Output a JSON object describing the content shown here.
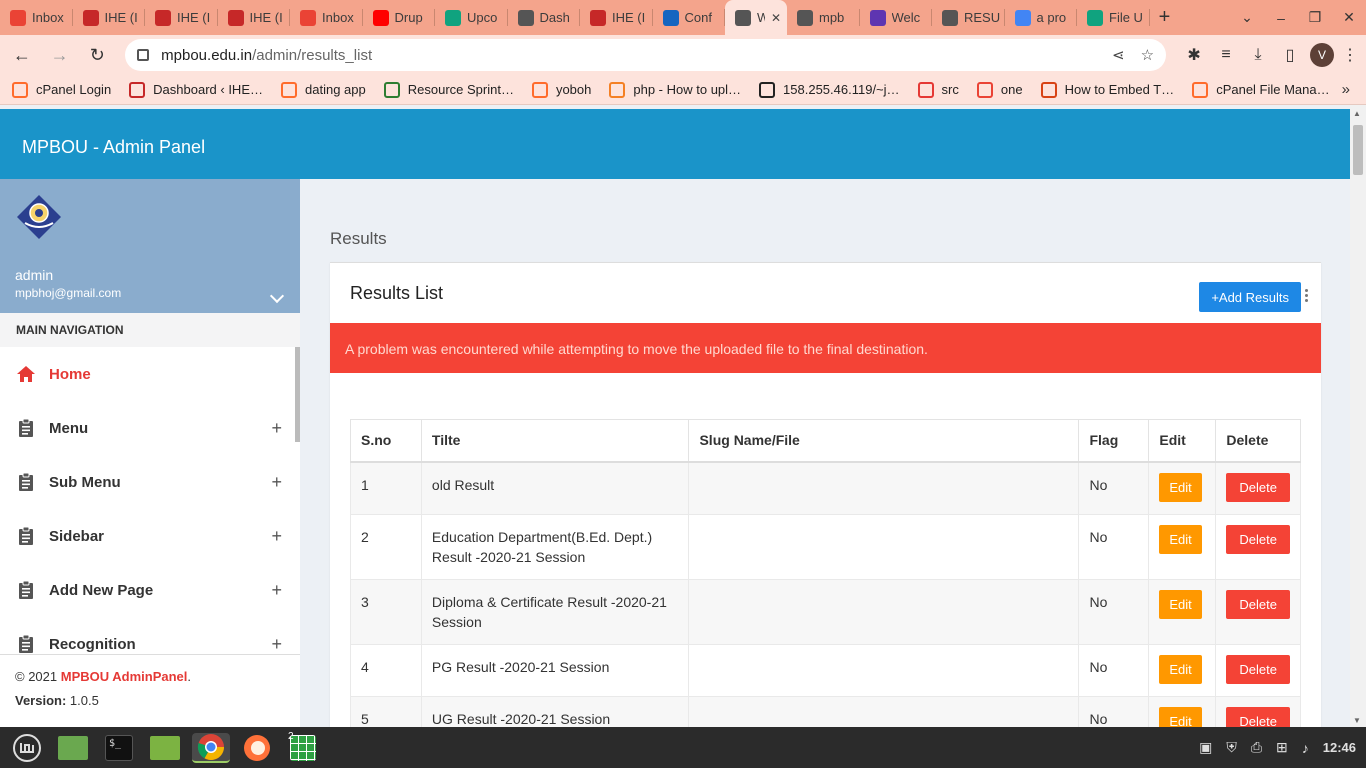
{
  "browser": {
    "tabs": [
      {
        "title": "Inbox",
        "icon": "gmail-icon",
        "color": "#ea4335"
      },
      {
        "title": "IHE (I",
        "icon": "ihe-icon",
        "color": "#c62828"
      },
      {
        "title": "IHE (I",
        "icon": "ihe-icon",
        "color": "#c62828"
      },
      {
        "title": "IHE (I",
        "icon": "ihe-icon",
        "color": "#c62828"
      },
      {
        "title": "Inbox",
        "icon": "gmail-icon",
        "color": "#ea4335"
      },
      {
        "title": "Drup",
        "icon": "youtube-icon",
        "color": "#ff0000"
      },
      {
        "title": "Upco",
        "icon": "chatgpt-icon",
        "color": "#10a37f"
      },
      {
        "title": "Dash",
        "icon": "globe-icon",
        "color": "#555555"
      },
      {
        "title": "IHE (I",
        "icon": "ihe-icon",
        "color": "#c62828"
      },
      {
        "title": "Conf",
        "icon": "site-icon",
        "color": "#1565c0"
      },
      {
        "title": "W",
        "icon": "globe-icon",
        "color": "#555555",
        "active": true
      },
      {
        "title": "mpb",
        "icon": "globe-icon",
        "color": "#555555"
      },
      {
        "title": "Welc",
        "icon": "mpbou-icon",
        "color": "#5e35b1"
      },
      {
        "title": "RESU",
        "icon": "globe-icon",
        "color": "#555555"
      },
      {
        "title": "a pro",
        "icon": "google-icon",
        "color": "#4285f4"
      },
      {
        "title": "File U",
        "icon": "chatgpt-icon",
        "color": "#10a37f"
      }
    ],
    "url_host": "mpbou.edu.in",
    "url_path": "/admin/results_list",
    "profile_initial": "V",
    "bookmarks": [
      {
        "label": "cPanel Login",
        "icon": "cpanel-icon"
      },
      {
        "label": "Dashboard ‹ IHE…",
        "icon": "ihe-icon"
      },
      {
        "label": "dating app",
        "icon": "cpanel-icon"
      },
      {
        "label": "Resource Sprint…",
        "icon": "plus-square-icon"
      },
      {
        "label": "yoboh",
        "icon": "cpanel-icon"
      },
      {
        "label": "php - How to upl…",
        "icon": "stackoverflow-icon"
      },
      {
        "label": "158.255.46.119/~j…",
        "icon": "globe-icon"
      },
      {
        "label": "src",
        "icon": "fire-icon"
      },
      {
        "label": "one",
        "icon": "gmail-icon"
      },
      {
        "label": "How to Embed T…",
        "icon": "rooster-icon"
      },
      {
        "label": "cPanel File Mana…",
        "icon": "cpanel-icon"
      }
    ]
  },
  "app": {
    "brand": "MPBOU - Admin Panel",
    "user": {
      "name": "admin",
      "email": "mpbhoj@gmail.com"
    },
    "nav_header": "MAIN NAVIGATION",
    "nav": [
      {
        "label": "Home",
        "icon": "home-icon"
      },
      {
        "label": "Menu",
        "icon": "clipboard-icon"
      },
      {
        "label": "Sub Menu",
        "icon": "clipboard-icon"
      },
      {
        "label": "Sidebar",
        "icon": "clipboard-icon"
      },
      {
        "label": "Add New Page",
        "icon": "clipboard-icon"
      },
      {
        "label": "Recognition",
        "icon": "clipboard-icon"
      }
    ],
    "footer": {
      "copyright": "© 2021",
      "brand": "MPBOU AdminPanel",
      "period": ".",
      "version_label": "Version:",
      "version": "1.0.5"
    },
    "breadcrumb": "Results",
    "card_title": "Results List",
    "add_button": "+Add Results",
    "alert": "A problem was encountered while attempting to move the uploaded file to the final destination.",
    "table": {
      "headers": [
        "S.no",
        "Tilte",
        "Slug Name/File",
        "Flag",
        "Edit",
        "Delete"
      ],
      "rows": [
        {
          "sno": "1",
          "title": "old Result",
          "slug": "",
          "flag": "No"
        },
        {
          "sno": "2",
          "title": "Education Department(B.Ed. Dept.) Result -2020-21 Session",
          "slug": "",
          "flag": "No"
        },
        {
          "sno": "3",
          "title": "Diploma & Certificate Result -2020-21 Session",
          "slug": "",
          "flag": "No"
        },
        {
          "sno": "4",
          "title": "PG Result -2020-21 Session",
          "slug": "",
          "flag": "No"
        },
        {
          "sno": "5",
          "title": "UG Result -2020-21 Session",
          "slug": "",
          "flag": "No"
        }
      ],
      "edit_label": "Edit",
      "delete_label": "Delete"
    }
  },
  "taskbar": {
    "apps": [
      "mint-menu-icon",
      "files-icon",
      "terminal-icon",
      "folder-icon",
      "chrome-icon",
      "firefox-icon",
      "spreadsheet-icon"
    ],
    "badge": "2",
    "clock": "12:46"
  }
}
